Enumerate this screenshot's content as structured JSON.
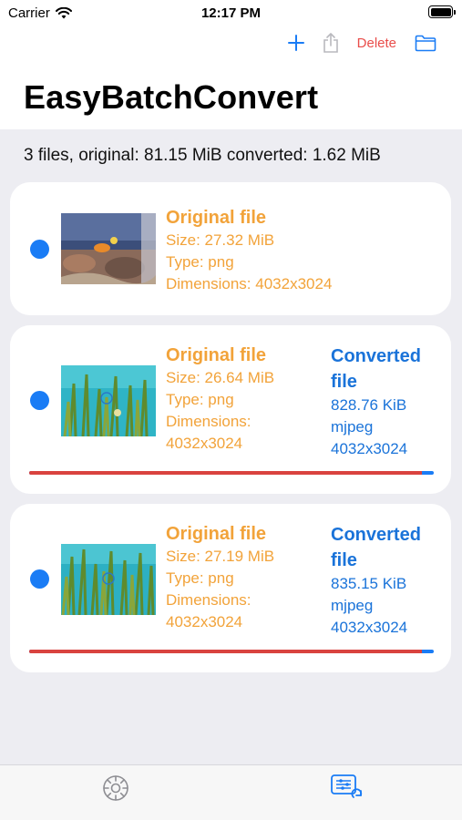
{
  "status_bar": {
    "carrier": "Carrier",
    "time": "12:17 PM"
  },
  "nav": {
    "delete_label": "Delete"
  },
  "title": "EasyBatchConvert",
  "summary": "3 files, original: 81.15 MiB  converted: 1.62 MiB",
  "files": [
    {
      "original_title": "Original file",
      "size": "Size: 27.32 MiB",
      "type": "Type: png",
      "dimensions": "Dimensions: 4032x3024"
    },
    {
      "original_title": "Original file",
      "size": "Size: 26.64 MiB",
      "type": "Type: png",
      "dimensions_label": "Dimensions:",
      "dimensions_value": "4032x3024",
      "converted_title_1": "Converted",
      "converted_title_2": "file",
      "converted_size": "828.76 KiB",
      "converted_type": "mjpeg",
      "converted_dimensions": "4032x3024",
      "progress": 0.97
    },
    {
      "original_title": "Original file",
      "size": "Size: 27.19 MiB",
      "type": "Type: png",
      "dimensions_label": "Dimensions:",
      "dimensions_value": "4032x3024",
      "converted_title_1": "Converted",
      "converted_title_2": "file",
      "converted_size": "835.15 KiB",
      "converted_type": "mjpeg",
      "converted_dimensions": "4032x3024",
      "progress": 0.97
    }
  ],
  "colors": {
    "accent": "#1a7cf5",
    "original_text": "#f2a33a",
    "converted_text": "#1a73d9",
    "delete": "#e94d4a",
    "progress": "#d9433f"
  },
  "icons": {
    "add": "plus-icon",
    "share": "share-icon",
    "folder": "folder-icon",
    "settings_tab": "gear-icon",
    "convert_tab": "convert-settings-icon"
  }
}
